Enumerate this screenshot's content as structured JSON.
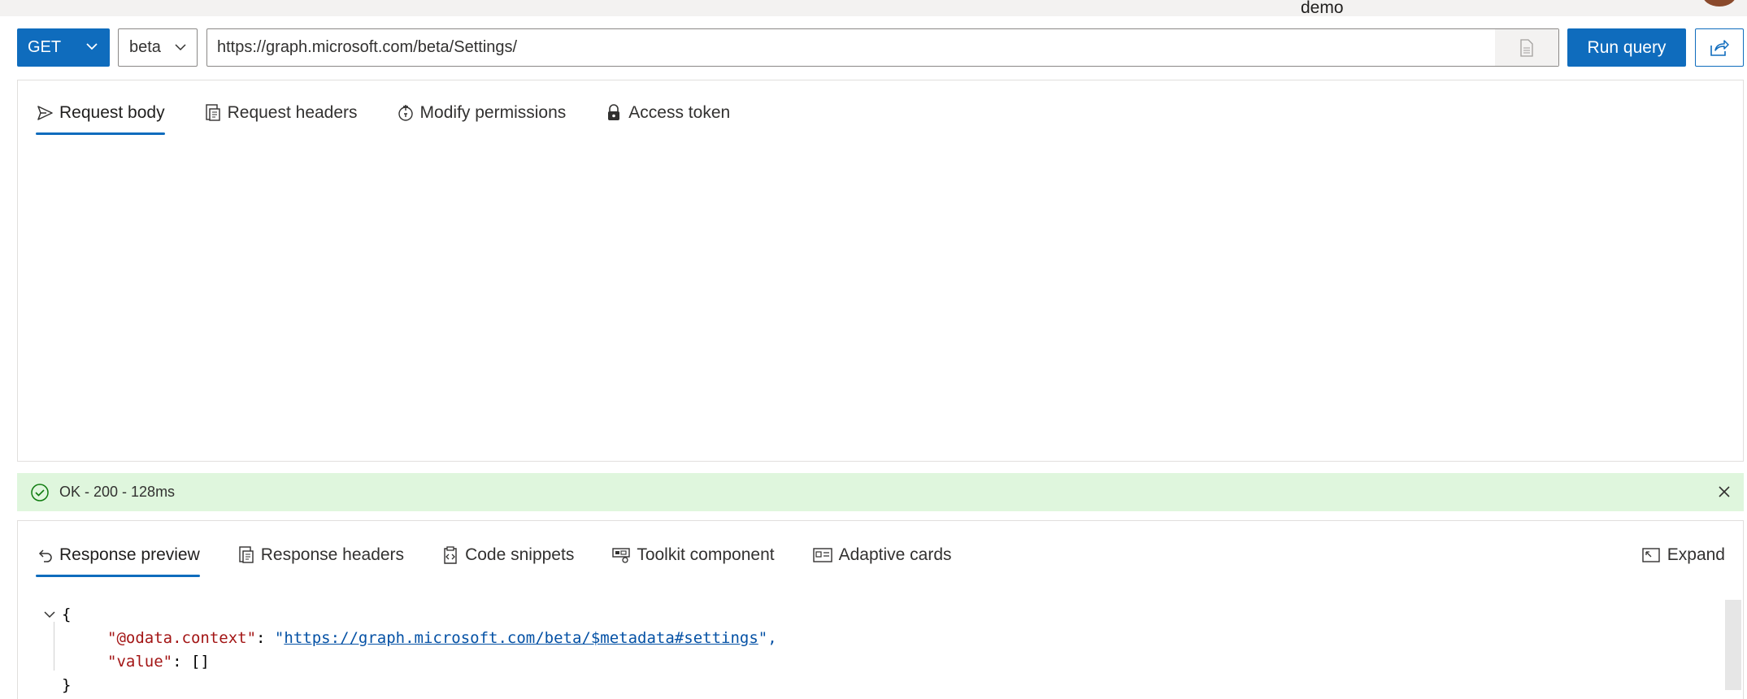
{
  "top": {
    "username": "demo"
  },
  "query": {
    "method": "GET",
    "version": "beta",
    "url": "https://graph.microsoft.com/beta/Settings/",
    "run_label": "Run query"
  },
  "request_tabs": [
    {
      "label": "Request body",
      "icon": "send-icon",
      "active": true
    },
    {
      "label": "Request headers",
      "icon": "headers-icon",
      "active": false
    },
    {
      "label": "Modify permissions",
      "icon": "permissions-icon",
      "active": false
    },
    {
      "label": "Access token",
      "icon": "lock-icon",
      "active": false
    }
  ],
  "status": {
    "text": "OK - 200 - 128ms",
    "color": "#dff6dd"
  },
  "response_tabs": [
    {
      "label": "Response preview",
      "icon": "undo-icon",
      "active": true
    },
    {
      "label": "Response headers",
      "icon": "headers-icon",
      "active": false
    },
    {
      "label": "Code snippets",
      "icon": "clipboard-code-icon",
      "active": false
    },
    {
      "label": "Toolkit component",
      "icon": "toolkit-icon",
      "active": false
    },
    {
      "label": "Adaptive cards",
      "icon": "card-icon",
      "active": false
    }
  ],
  "expand_label": "Expand",
  "response": {
    "open": "{",
    "context_key": "\"@odata.context\"",
    "context_sep": ": ",
    "context_quote_open": "\"",
    "context_value": "https://graph.microsoft.com/beta/$metadata#settings",
    "context_quote_close": "\",",
    "value_key": "\"value\"",
    "value_rest": ": []",
    "close": "}"
  },
  "colors": {
    "accent": "#0f6cbd",
    "success": "#107c10",
    "string_key": "#a31515",
    "link": "#0451a5"
  }
}
